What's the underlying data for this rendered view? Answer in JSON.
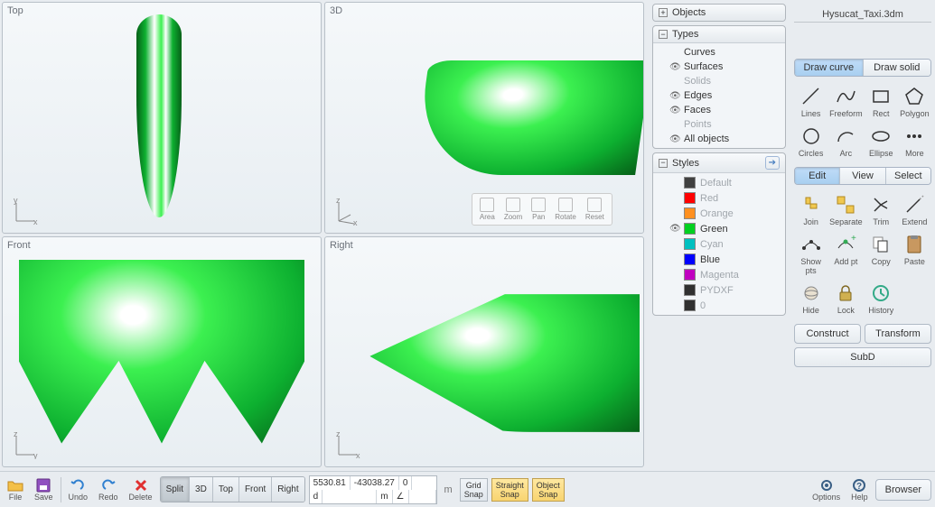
{
  "filename": "Hysucat_Taxi.3dm",
  "viewports": {
    "top": "Top",
    "threeD": "3D",
    "front": "Front",
    "right": "Right"
  },
  "viewTools": [
    "Area",
    "Zoom",
    "Pan",
    "Rotate",
    "Reset"
  ],
  "scenePanel": {
    "objects": {
      "label": "Objects"
    },
    "types": {
      "label": "Types",
      "items": [
        {
          "label": "Curves",
          "visible": false,
          "dimmed": false
        },
        {
          "label": "Surfaces",
          "visible": true,
          "dimmed": false
        },
        {
          "label": "Solids",
          "visible": false,
          "dimmed": true
        },
        {
          "label": "Edges",
          "visible": true,
          "dimmed": false
        },
        {
          "label": "Faces",
          "visible": true,
          "dimmed": false
        },
        {
          "label": "Points",
          "visible": false,
          "dimmed": true
        },
        {
          "label": "All objects",
          "visible": true,
          "dimmed": false
        }
      ]
    },
    "styles": {
      "label": "Styles",
      "items": [
        {
          "label": "Default",
          "color": "#404040",
          "visible": false,
          "dimmed": true
        },
        {
          "label": "Red",
          "color": "#ff0000",
          "visible": false,
          "dimmed": true
        },
        {
          "label": "Orange",
          "color": "#ff9020",
          "visible": false,
          "dimmed": true
        },
        {
          "label": "Green",
          "color": "#00d020",
          "visible": true,
          "dimmed": false
        },
        {
          "label": "Cyan",
          "color": "#00c0c0",
          "visible": false,
          "dimmed": true
        },
        {
          "label": "Blue",
          "color": "#0000ff",
          "visible": false,
          "dimmed": false
        },
        {
          "label": "Magenta",
          "color": "#c000c0",
          "visible": false,
          "dimmed": true
        },
        {
          "label": "PYDXF",
          "color": "#303030",
          "visible": false,
          "dimmed": true
        },
        {
          "label": "0",
          "color": "#303030",
          "visible": false,
          "dimmed": true
        }
      ]
    }
  },
  "toolPanel": {
    "drawTabs": [
      "Draw curve",
      "Draw solid"
    ],
    "drawTools": [
      {
        "label": "Lines",
        "icon": "line"
      },
      {
        "label": "Freeform",
        "icon": "freeform"
      },
      {
        "label": "Rect",
        "icon": "rect"
      },
      {
        "label": "Polygon",
        "icon": "polygon"
      },
      {
        "label": "Circles",
        "icon": "circle"
      },
      {
        "label": "Arc",
        "icon": "arc"
      },
      {
        "label": "Ellipse",
        "icon": "ellipse"
      },
      {
        "label": "More",
        "icon": "more"
      }
    ],
    "modeTabs": [
      "Edit",
      "View",
      "Select"
    ],
    "editTools": [
      {
        "label": "Join",
        "icon": "join"
      },
      {
        "label": "Separate",
        "icon": "separate"
      },
      {
        "label": "Trim",
        "icon": "trim"
      },
      {
        "label": "Extend",
        "icon": "extend"
      },
      {
        "label": "Show pts",
        "icon": "showpts"
      },
      {
        "label": "Add pt",
        "icon": "addpt"
      },
      {
        "label": "Copy",
        "icon": "copy"
      },
      {
        "label": "Paste",
        "icon": "paste"
      },
      {
        "label": "Hide",
        "icon": "hide"
      },
      {
        "label": "Lock",
        "icon": "lock"
      },
      {
        "label": "History",
        "icon": "history"
      }
    ],
    "construct": "Construct",
    "transform": "Transform",
    "subd": "SubD"
  },
  "bottomBar": {
    "file": "File",
    "save": "Save",
    "undo": "Undo",
    "redo": "Redo",
    "delete": "Delete",
    "viewButtons": [
      "Split",
      "3D",
      "Top",
      "Front",
      "Right"
    ],
    "coords": {
      "x": "5530.81",
      "y": "-43038.27",
      "z": "0",
      "dist": "",
      "angle": "",
      "unit_mm": "m",
      "unit_m": "m"
    },
    "gridSnap": {
      "line1": "Grid",
      "line2": "Snap"
    },
    "straightSnap": {
      "line1": "Straight",
      "line2": "Snap"
    },
    "objectSnap": {
      "line1": "Object",
      "line2": "Snap"
    },
    "options": "Options",
    "help": "Help",
    "browser": "Browser"
  }
}
